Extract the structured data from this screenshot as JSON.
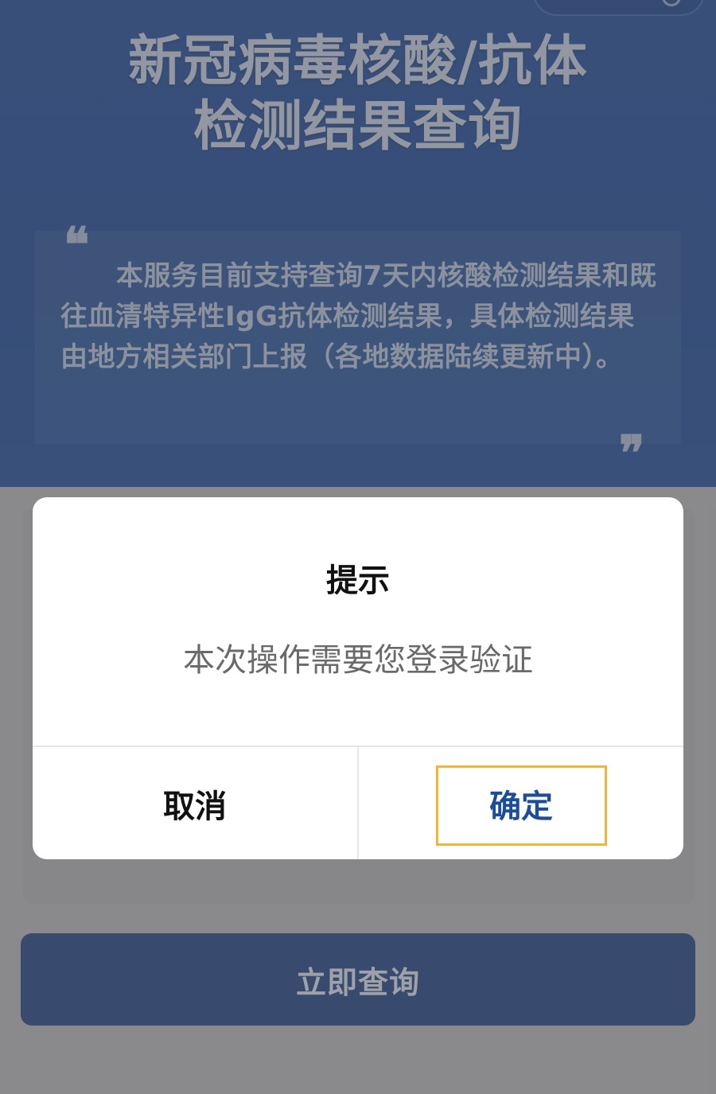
{
  "header": {
    "title_line1": "新冠病毒核酸/抗体",
    "title_line2": "检测结果查询",
    "notice": "本服务目前支持查询7天内核酸检测结果和既往血清特异性IgG抗体检测结果，具体检测结果由地方相关部门上报（各地数据陆续更新中）。",
    "quote_open": "❝",
    "quote_close": "❞"
  },
  "main": {
    "query_button_label": "立即查询"
  },
  "dialog": {
    "title": "提示",
    "message": "本次操作需要您登录验证",
    "cancel_label": "取消",
    "confirm_label": "确定"
  },
  "colors": {
    "header_bg": "#0c3b8c",
    "query_button_bg": "#0b2f6e",
    "confirm_text": "#1d4d96",
    "focus_ring": "#f2b634"
  }
}
